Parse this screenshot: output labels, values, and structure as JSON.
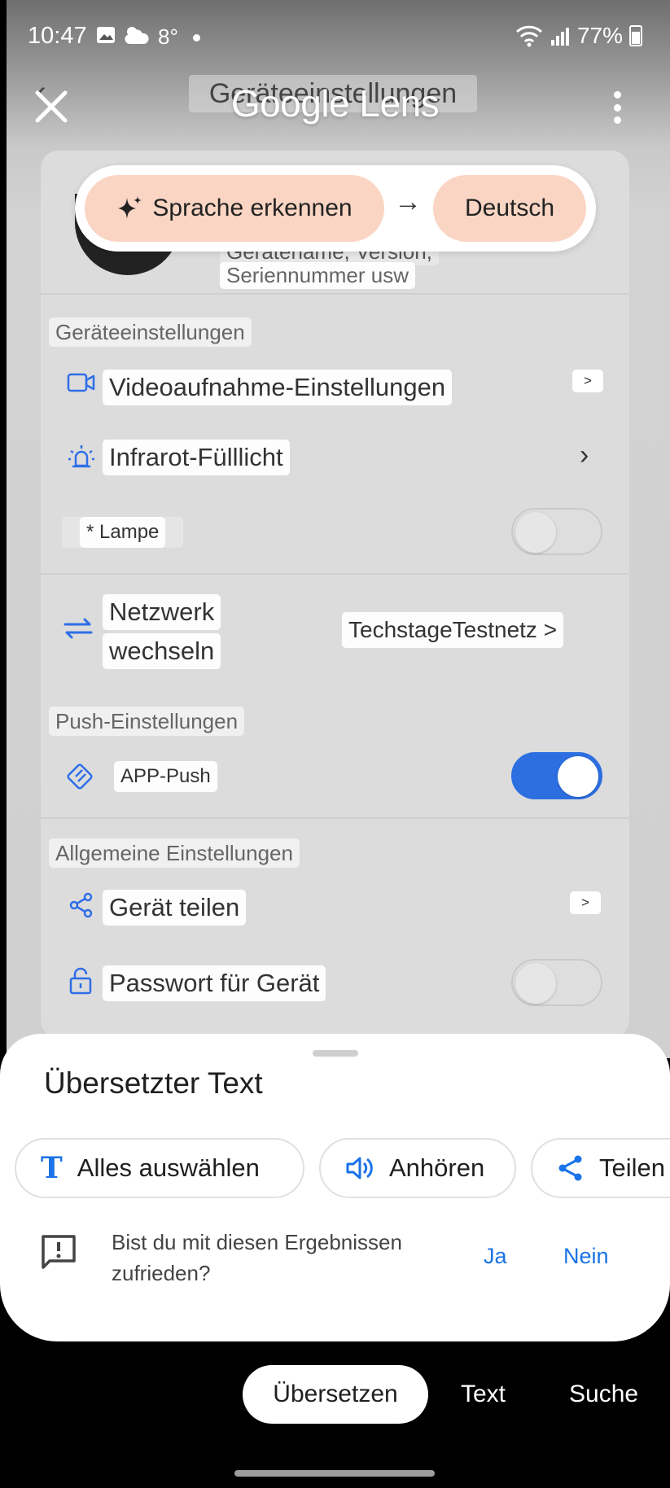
{
  "status_bar": {
    "time": "10:47",
    "temperature": "8°",
    "battery": "77%"
  },
  "lens": {
    "title": "Google Lens",
    "background_title": "Geräteeinstellungen",
    "source_language": "Sprache erkennen",
    "target_language": "Deutsch"
  },
  "translated": {
    "device_info_line1": "Gerätename, Version,",
    "device_info_line2": "Seriennummer usw",
    "section_device": "Geräteeinstellungen",
    "video_settings": "Videoaufnahme-Einstellungen",
    "mini_chevron": ">",
    "infrared": "Infrarot-Fülllicht",
    "lamp": "* Lampe",
    "network_line1": "Netzwerk",
    "network_line2": "wechseln",
    "network_value": "TechstageTestnetz >",
    "section_push": "Push-Einstellungen",
    "app_push": "APP-Push",
    "section_general": "Allgemeine Einstellungen",
    "share_device": "Gerät teilen",
    "device_password": "Passwort für Gerät"
  },
  "sheet": {
    "title": "Übersetzter Text",
    "select_all": "Alles auswählen",
    "listen": "Anhören",
    "share": "Teilen",
    "feedback_question": "Bist du mit diesen Ergebnissen zufrieden?",
    "yes": "Ja",
    "no": "Nein"
  },
  "modes": {
    "translate": "Übersetzen",
    "text": "Text",
    "search": "Suche"
  },
  "colors": {
    "accent_blue": "#1a73e8",
    "toggle_on": "#2d6fe1",
    "language_chip": "#fad5c4"
  }
}
